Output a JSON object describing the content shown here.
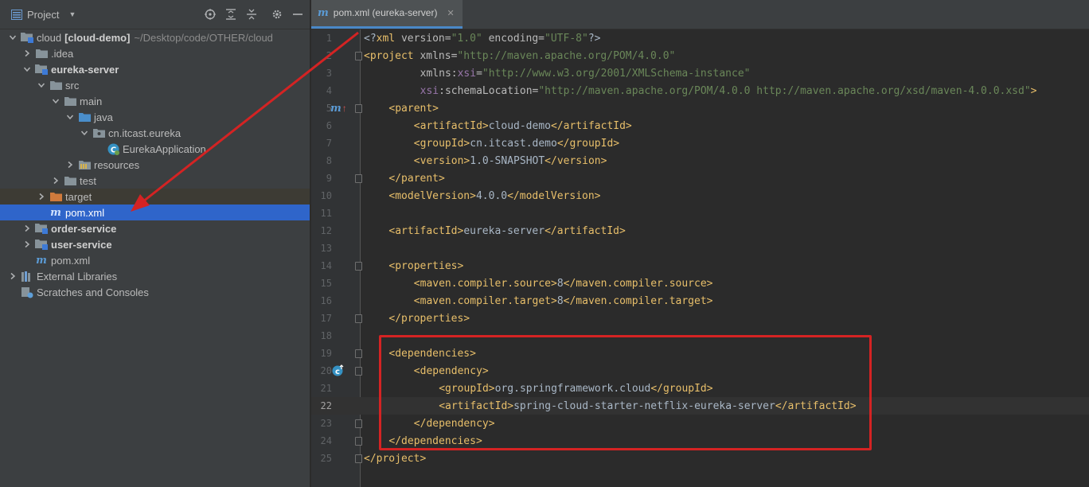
{
  "project_panel": {
    "title": "Project",
    "tree": [
      {
        "depth": 0,
        "arrow": "down",
        "icon": "module-folder-icon",
        "label": "cloud",
        "bold_suffix": "[cloud-demo]",
        "dim": "~/Desktop/code/OTHER/cloud"
      },
      {
        "depth": 1,
        "arrow": "right",
        "icon": "folder-icon",
        "label": ".idea"
      },
      {
        "depth": 1,
        "arrow": "down",
        "icon": "module-folder-icon",
        "label": "eureka-server",
        "bold": true
      },
      {
        "depth": 2,
        "arrow": "down",
        "icon": "folder-icon",
        "label": "src"
      },
      {
        "depth": 3,
        "arrow": "down",
        "icon": "folder-icon",
        "label": "main"
      },
      {
        "depth": 4,
        "arrow": "down",
        "icon": "source-folder-icon",
        "label": "java"
      },
      {
        "depth": 5,
        "arrow": "down",
        "icon": "package-icon",
        "label": "cn.itcast.eureka"
      },
      {
        "depth": 6,
        "arrow": "none",
        "icon": "spring-class-icon",
        "label": "EurekaApplication"
      },
      {
        "depth": 4,
        "arrow": "right",
        "icon": "resources-folder-icon",
        "label": "resources"
      },
      {
        "depth": 3,
        "arrow": "right",
        "icon": "folder-icon",
        "label": "test"
      },
      {
        "depth": 2,
        "arrow": "right",
        "icon": "excluded-folder-icon",
        "label": "target",
        "excluded": true
      },
      {
        "depth": 2,
        "arrow": "none",
        "icon": "maven-icon",
        "label": "pom.xml",
        "selected": true
      },
      {
        "depth": 1,
        "arrow": "right",
        "icon": "module-folder-icon",
        "label": "order-service",
        "bold": true
      },
      {
        "depth": 1,
        "arrow": "right",
        "icon": "module-folder-icon",
        "label": "user-service",
        "bold": true
      },
      {
        "depth": 1,
        "arrow": "none",
        "icon": "maven-icon",
        "label": "pom.xml"
      },
      {
        "depth": 0,
        "arrow": "right",
        "icon": "libraries-icon",
        "label": "External Libraries"
      },
      {
        "depth": 0,
        "arrow": "none",
        "icon": "scratches-icon",
        "label": "Scratches and Consoles"
      }
    ]
  },
  "editor": {
    "tab_label": "pom.xml (eureka-server)",
    "current_line": 22,
    "lines": [
      {
        "n": "1",
        "indent": 0,
        "t": [
          [
            "p",
            "<?"
          ],
          [
            "tg",
            "xml "
          ],
          [
            "an",
            "version="
          ],
          [
            "av",
            "\"1.0\" "
          ],
          [
            "an",
            "encoding="
          ],
          [
            "av",
            "\"UTF-8\""
          ],
          [
            "p",
            "?>"
          ]
        ]
      },
      {
        "n": "2",
        "indent": 0,
        "t": [
          [
            "tg",
            "<project "
          ],
          [
            "an",
            "xmlns="
          ],
          [
            "av",
            "\"http://maven.apache.org/POM/4.0.0\""
          ]
        ]
      },
      {
        "n": "3",
        "indent": 9,
        "t": [
          [
            "an",
            "xmlns:"
          ],
          [
            "ns",
            "xsi"
          ],
          [
            "an",
            "="
          ],
          [
            "av",
            "\"http://www.w3.org/2001/XMLSchema-instance\""
          ]
        ]
      },
      {
        "n": "4",
        "indent": 9,
        "t": [
          [
            "ns",
            "xsi"
          ],
          [
            "an",
            ":schemaLocation="
          ],
          [
            "av",
            "\"http://maven.apache.org/POM/4.0.0 http://maven.apache.org/xsd/maven-4.0.0.xsd\""
          ],
          [
            "tg",
            ">"
          ]
        ]
      },
      {
        "n": "5",
        "indent": 4,
        "t": [
          [
            "tg",
            "<parent>"
          ]
        ]
      },
      {
        "n": "6",
        "indent": 8,
        "t": [
          [
            "tg",
            "<artifactId>"
          ],
          [
            "p",
            "cloud-demo"
          ],
          [
            "tg",
            "</artifactId>"
          ]
        ]
      },
      {
        "n": "7",
        "indent": 8,
        "t": [
          [
            "tg",
            "<groupId>"
          ],
          [
            "p",
            "cn.itcast.demo"
          ],
          [
            "tg",
            "</groupId>"
          ]
        ]
      },
      {
        "n": "8",
        "indent": 8,
        "t": [
          [
            "tg",
            "<version>"
          ],
          [
            "p",
            "1.0-SNAPSHOT"
          ],
          [
            "tg",
            "</version>"
          ]
        ]
      },
      {
        "n": "9",
        "indent": 4,
        "t": [
          [
            "tg",
            "</parent>"
          ]
        ]
      },
      {
        "n": "10",
        "indent": 4,
        "t": [
          [
            "tg",
            "<modelVersion>"
          ],
          [
            "p",
            "4.0.0"
          ],
          [
            "tg",
            "</modelVersion>"
          ]
        ]
      },
      {
        "n": "11",
        "indent": 0,
        "t": []
      },
      {
        "n": "12",
        "indent": 4,
        "t": [
          [
            "tg",
            "<artifactId>"
          ],
          [
            "p",
            "eureka-server"
          ],
          [
            "tg",
            "</artifactId>"
          ]
        ]
      },
      {
        "n": "13",
        "indent": 0,
        "t": []
      },
      {
        "n": "14",
        "indent": 4,
        "t": [
          [
            "tg",
            "<properties>"
          ]
        ]
      },
      {
        "n": "15",
        "indent": 8,
        "t": [
          [
            "tg",
            "<maven.compiler.source>"
          ],
          [
            "p",
            "8"
          ],
          [
            "tg",
            "</maven.compiler.source>"
          ]
        ]
      },
      {
        "n": "16",
        "indent": 8,
        "t": [
          [
            "tg",
            "<maven.compiler.target>"
          ],
          [
            "p",
            "8"
          ],
          [
            "tg",
            "</maven.compiler.target>"
          ]
        ]
      },
      {
        "n": "17",
        "indent": 4,
        "t": [
          [
            "tg",
            "</properties>"
          ]
        ]
      },
      {
        "n": "18",
        "indent": 0,
        "t": []
      },
      {
        "n": "19",
        "indent": 4,
        "t": [
          [
            "tg",
            "<dependencies>"
          ]
        ]
      },
      {
        "n": "20",
        "indent": 8,
        "t": [
          [
            "tg",
            "<dependency>"
          ]
        ]
      },
      {
        "n": "21",
        "indent": 12,
        "t": [
          [
            "tg",
            "<groupId>"
          ],
          [
            "p",
            "org.springframework.cloud"
          ],
          [
            "tg",
            "</groupId>"
          ]
        ]
      },
      {
        "n": "22",
        "indent": 12,
        "t": [
          [
            "tg",
            "<artifactId>"
          ],
          [
            "p",
            "spring-cloud-starter-netflix-eureka-server"
          ],
          [
            "tg",
            "</artifactId>"
          ]
        ]
      },
      {
        "n": "23",
        "indent": 8,
        "t": [
          [
            "tg",
            "</dependency>"
          ]
        ]
      },
      {
        "n": "24",
        "indent": 4,
        "t": [
          [
            "tg",
            "</dependencies>"
          ]
        ]
      },
      {
        "n": "25",
        "indent": 0,
        "t": [
          [
            "tg",
            "</project>"
          ]
        ]
      }
    ]
  },
  "colors": {
    "accent": "#2f65ca",
    "annotation": "#d42323"
  }
}
